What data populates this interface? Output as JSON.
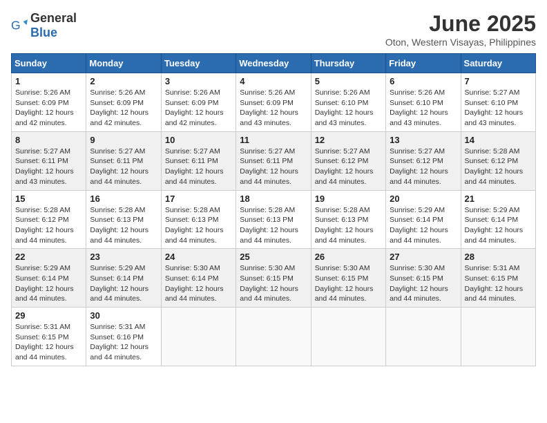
{
  "logo": {
    "general": "General",
    "blue": "Blue"
  },
  "title": "June 2025",
  "subtitle": "Oton, Western Visayas, Philippines",
  "days_header": [
    "Sunday",
    "Monday",
    "Tuesday",
    "Wednesday",
    "Thursday",
    "Friday",
    "Saturday"
  ],
  "weeks": [
    {
      "shaded": false,
      "days": [
        {
          "num": "1",
          "sunrise": "5:26 AM",
          "sunset": "6:09 PM",
          "daylight": "12 hours and 42 minutes."
        },
        {
          "num": "2",
          "sunrise": "5:26 AM",
          "sunset": "6:09 PM",
          "daylight": "12 hours and 42 minutes."
        },
        {
          "num": "3",
          "sunrise": "5:26 AM",
          "sunset": "6:09 PM",
          "daylight": "12 hours and 42 minutes."
        },
        {
          "num": "4",
          "sunrise": "5:26 AM",
          "sunset": "6:09 PM",
          "daylight": "12 hours and 43 minutes."
        },
        {
          "num": "5",
          "sunrise": "5:26 AM",
          "sunset": "6:10 PM",
          "daylight": "12 hours and 43 minutes."
        },
        {
          "num": "6",
          "sunrise": "5:26 AM",
          "sunset": "6:10 PM",
          "daylight": "12 hours and 43 minutes."
        },
        {
          "num": "7",
          "sunrise": "5:27 AM",
          "sunset": "6:10 PM",
          "daylight": "12 hours and 43 minutes."
        }
      ]
    },
    {
      "shaded": true,
      "days": [
        {
          "num": "8",
          "sunrise": "5:27 AM",
          "sunset": "6:11 PM",
          "daylight": "12 hours and 43 minutes."
        },
        {
          "num": "9",
          "sunrise": "5:27 AM",
          "sunset": "6:11 PM",
          "daylight": "12 hours and 44 minutes."
        },
        {
          "num": "10",
          "sunrise": "5:27 AM",
          "sunset": "6:11 PM",
          "daylight": "12 hours and 44 minutes."
        },
        {
          "num": "11",
          "sunrise": "5:27 AM",
          "sunset": "6:11 PM",
          "daylight": "12 hours and 44 minutes."
        },
        {
          "num": "12",
          "sunrise": "5:27 AM",
          "sunset": "6:12 PM",
          "daylight": "12 hours and 44 minutes."
        },
        {
          "num": "13",
          "sunrise": "5:27 AM",
          "sunset": "6:12 PM",
          "daylight": "12 hours and 44 minutes."
        },
        {
          "num": "14",
          "sunrise": "5:28 AM",
          "sunset": "6:12 PM",
          "daylight": "12 hours and 44 minutes."
        }
      ]
    },
    {
      "shaded": false,
      "days": [
        {
          "num": "15",
          "sunrise": "5:28 AM",
          "sunset": "6:12 PM",
          "daylight": "12 hours and 44 minutes."
        },
        {
          "num": "16",
          "sunrise": "5:28 AM",
          "sunset": "6:13 PM",
          "daylight": "12 hours and 44 minutes."
        },
        {
          "num": "17",
          "sunrise": "5:28 AM",
          "sunset": "6:13 PM",
          "daylight": "12 hours and 44 minutes."
        },
        {
          "num": "18",
          "sunrise": "5:28 AM",
          "sunset": "6:13 PM",
          "daylight": "12 hours and 44 minutes."
        },
        {
          "num": "19",
          "sunrise": "5:28 AM",
          "sunset": "6:13 PM",
          "daylight": "12 hours and 44 minutes."
        },
        {
          "num": "20",
          "sunrise": "5:29 AM",
          "sunset": "6:14 PM",
          "daylight": "12 hours and 44 minutes."
        },
        {
          "num": "21",
          "sunrise": "5:29 AM",
          "sunset": "6:14 PM",
          "daylight": "12 hours and 44 minutes."
        }
      ]
    },
    {
      "shaded": true,
      "days": [
        {
          "num": "22",
          "sunrise": "5:29 AM",
          "sunset": "6:14 PM",
          "daylight": "12 hours and 44 minutes."
        },
        {
          "num": "23",
          "sunrise": "5:29 AM",
          "sunset": "6:14 PM",
          "daylight": "12 hours and 44 minutes."
        },
        {
          "num": "24",
          "sunrise": "5:30 AM",
          "sunset": "6:14 PM",
          "daylight": "12 hours and 44 minutes."
        },
        {
          "num": "25",
          "sunrise": "5:30 AM",
          "sunset": "6:15 PM",
          "daylight": "12 hours and 44 minutes."
        },
        {
          "num": "26",
          "sunrise": "5:30 AM",
          "sunset": "6:15 PM",
          "daylight": "12 hours and 44 minutes."
        },
        {
          "num": "27",
          "sunrise": "5:30 AM",
          "sunset": "6:15 PM",
          "daylight": "12 hours and 44 minutes."
        },
        {
          "num": "28",
          "sunrise": "5:31 AM",
          "sunset": "6:15 PM",
          "daylight": "12 hours and 44 minutes."
        }
      ]
    },
    {
      "shaded": false,
      "days": [
        {
          "num": "29",
          "sunrise": "5:31 AM",
          "sunset": "6:15 PM",
          "daylight": "12 hours and 44 minutes."
        },
        {
          "num": "30",
          "sunrise": "5:31 AM",
          "sunset": "6:16 PM",
          "daylight": "12 hours and 44 minutes."
        },
        null,
        null,
        null,
        null,
        null
      ]
    }
  ]
}
